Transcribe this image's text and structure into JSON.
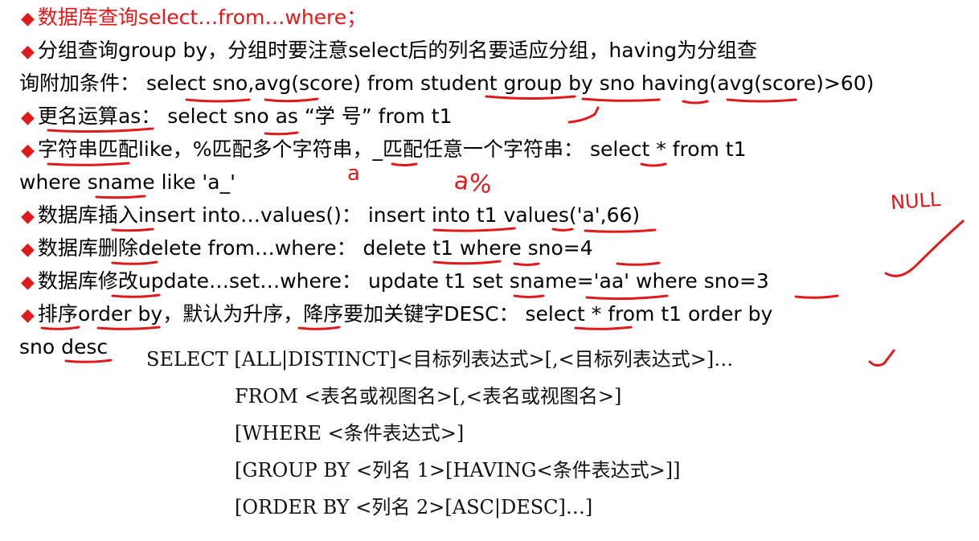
{
  "lines": {
    "l1": {
      "title": "数据库查询select…from…where；"
    },
    "l2": {
      "topic": "分组查询",
      "text": "group by，分组时要注意select后的列名要适应分组，having为分组查"
    },
    "l3": {
      "text": "询附加条件： select sno,avg(score) from student group by sno having(avg(score)>60)"
    },
    "l4": {
      "topic": "更名运算",
      "text": "as： select sno as “学 号” from t1"
    },
    "l5": {
      "topic": "字符串匹配",
      "text": "like，%匹配多个字符串，_匹配任意一个字符串： select * from t1"
    },
    "l6": {
      "text": "where sname like 'a_'"
    },
    "l7": {
      "topic": "数据库插入",
      "text": "insert into…values()： insert into t1 values('a',66)"
    },
    "l8": {
      "topic": "数据库删除",
      "text": "delete from…where： delete t1 where sno=4"
    },
    "l9": {
      "topic": "数据库修改",
      "text": "update…set…where： update t1 set sname='aa' where sno=3"
    },
    "l10": {
      "topic": "排序",
      "text": "order by，默认为升序，降序要加关键字DESC： select * from t1 order by"
    },
    "l11": {
      "text": "sno desc"
    }
  },
  "syntax": [
    "SELECT [ALL|DISTINCT]<目标列表达式>[,<目标列表达式>]…",
    "FROM <表名或视图名>[,<表名或视图名>]",
    "[WHERE <条件表达式>]",
    "[GROUP BY <列名 1>[HAVING<条件表达式>]]",
    "[ORDER BY <列名 2>[ASC|DESC]…]"
  ],
  "annotations": {
    "a1": "a",
    "a2": "a%",
    "null_note": "NULL"
  },
  "colors": {
    "accent": "#e01a1a",
    "text": "#000000"
  }
}
